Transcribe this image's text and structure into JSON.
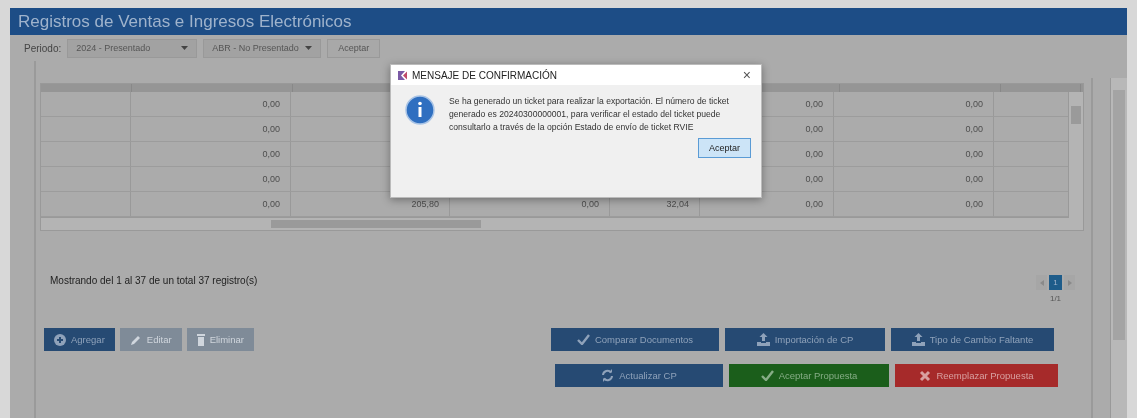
{
  "header": {
    "title": "Registros de Ventas e Ingresos Electrónicos"
  },
  "filter": {
    "label": "Periodo:",
    "year_select": "2024 - Presentado",
    "month_select": "ABR - No Presentado",
    "button": "Aceptar"
  },
  "table": {
    "rows": [
      {
        "cells": [
          null,
          "0,00",
          null,
          null,
          null,
          "0,00",
          "0,00"
        ]
      },
      {
        "cells": [
          null,
          "0,00",
          null,
          null,
          null,
          "0,00",
          "0,00"
        ]
      },
      {
        "cells": [
          null,
          "0,00",
          null,
          null,
          null,
          "0,00",
          "0,00"
        ]
      },
      {
        "cells": [
          null,
          "0,00",
          null,
          null,
          null,
          "0,00",
          "0,00"
        ]
      },
      {
        "cells": [
          null,
          "0,00",
          "205,80",
          "0,00",
          "32,04",
          "0,00",
          "0,00"
        ]
      }
    ]
  },
  "summary": "Mostrando del 1 al 37 de un total 37 registro(s)",
  "pagination": {
    "pages": [
      {
        "label": "1",
        "selected": true
      }
    ],
    "info": "1/1"
  },
  "left_buttons": [
    {
      "label": "Agregar",
      "disabled": false
    },
    {
      "label": "Editar",
      "disabled": true
    },
    {
      "label": "Eliminar",
      "disabled": true
    }
  ],
  "action_rows": [
    [
      {
        "label": "Comparar Documentos",
        "kind": "primary"
      },
      {
        "label": "Importación de CP",
        "kind": "primary"
      },
      {
        "label": "Tipo de Cambio Faltante",
        "kind": "primary"
      }
    ],
    [
      {
        "label": "Actualizar CP",
        "kind": "primary"
      },
      {
        "label": "Aceptar Propuesta",
        "kind": "success"
      },
      {
        "label": "Reemplazar Propuesta",
        "kind": "danger"
      }
    ]
  ],
  "dialog": {
    "title": "MENSAJE DE CONFIRMACIÓN",
    "close": "×",
    "message": "Se ha generado un ticket para realizar la exportación. El número de ticket generado es 20240300000001, para verificar el estado del ticket puede consultarlo a través de la opción Estado de envío de ticket RVIE",
    "button": "Aceptar"
  }
}
